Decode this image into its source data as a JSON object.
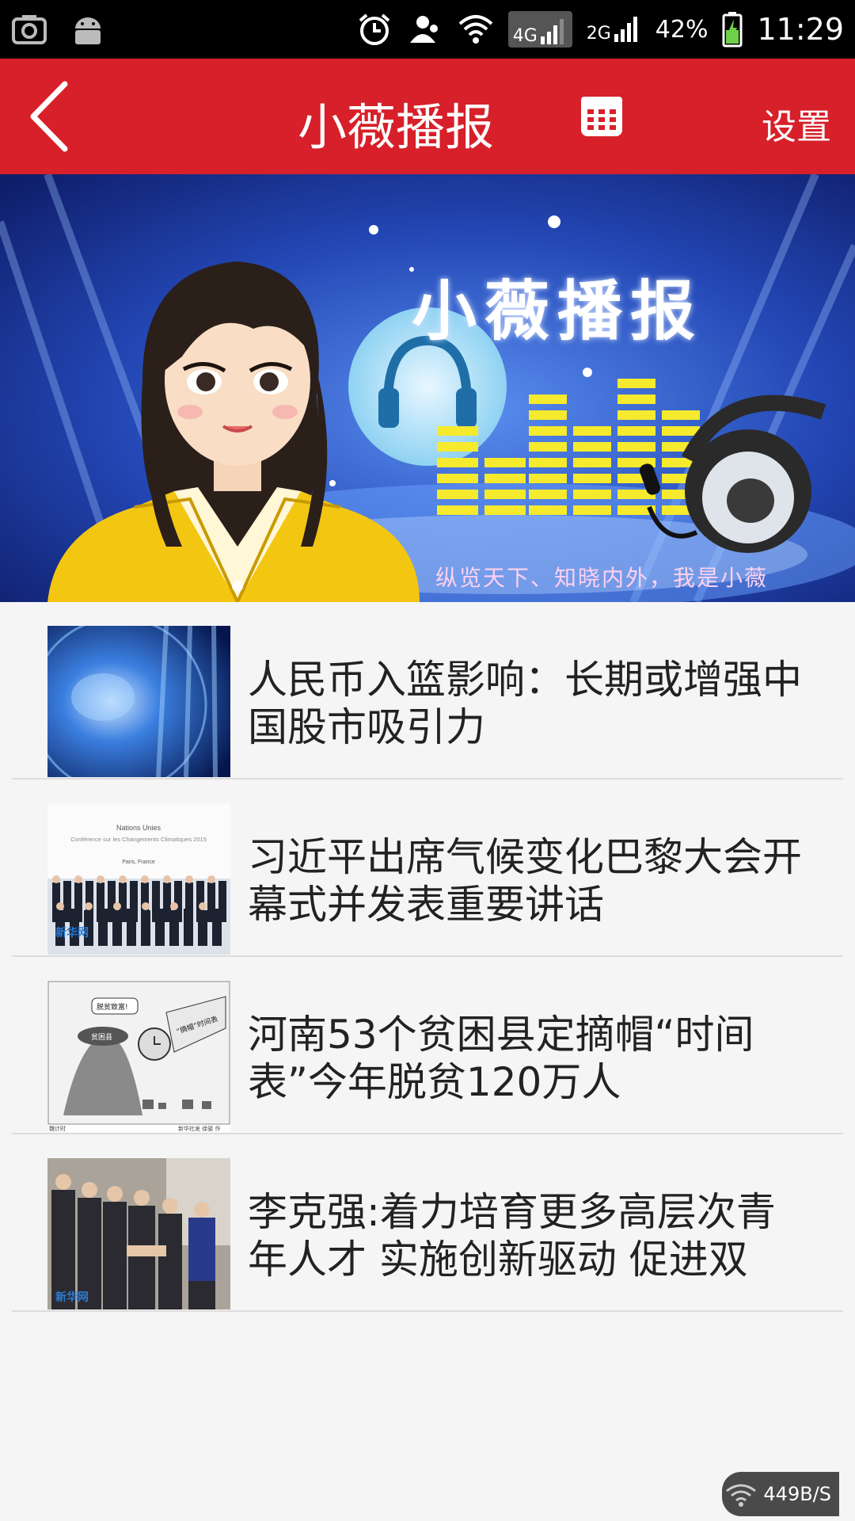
{
  "status_bar": {
    "battery": "42%",
    "time": "11:29",
    "network_4g": "4G",
    "network_2g": "2G"
  },
  "app_bar": {
    "title": "小薇播报",
    "settings_label": "设置"
  },
  "banner": {
    "title": "小薇播报",
    "slogan": "纵览天下、知晓内外，我是小薇"
  },
  "news": [
    {
      "title": "人民币入篮影响：长期或增强中国股市吸引力",
      "thumb": "globe-news-thumbnail"
    },
    {
      "title": "习近平出席气候变化巴黎大会开幕式并发表重要讲话",
      "thumb": "climate-conference-photo",
      "thumb_text": {
        "line1": "Nations Unies",
        "line2": "Conférence sur les Changements Climatiques 2015",
        "line3": "Paris, France",
        "watermark": "新华网"
      }
    },
    {
      "title": "河南53个贫困县定摘帽“时间表”今年脱贫120万人",
      "thumb": "poverty-cartoon",
      "thumb_text": {
        "bubble": "脱贫致富!",
        "hat": "贫困县",
        "banner": "“摘帽”时间表",
        "credit_left": "魏计时",
        "credit_right": "新华社发 徐骏 作"
      }
    },
    {
      "title": "李克强:着力培育更多高层次青年人才 实施创新驱动 促进双",
      "thumb": "meeting-photo",
      "thumb_text": {
        "watermark": "新华网"
      }
    }
  ],
  "net_speed": "449B/S",
  "colors": {
    "app_bar": "#d7202a",
    "status_bar": "#000000",
    "list_bg": "#f5f5f5",
    "banner_bg": "#1f3fae"
  }
}
